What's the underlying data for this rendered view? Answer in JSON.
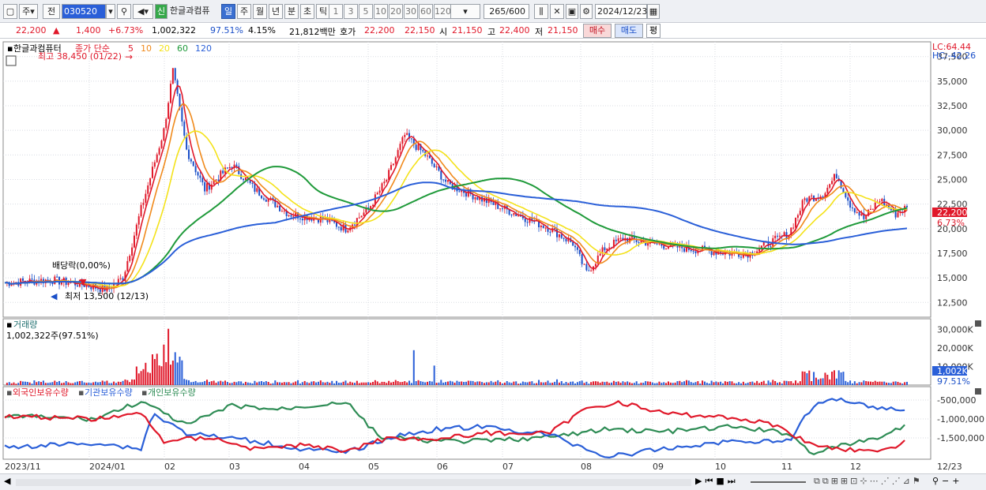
{
  "toolbar": {
    "period_main": "주",
    "prev": "전",
    "code": "030520",
    "new_badge": "신",
    "name": "한글과컴퓨",
    "periods": [
      "일",
      "주",
      "월",
      "년",
      "분",
      "초",
      "틱"
    ],
    "selected_period": "일",
    "intervals": [
      "1",
      "3",
      "5",
      "10",
      "20",
      "30",
      "60",
      "120"
    ],
    "count": "265",
    "total": "/600",
    "date": "2024/12/23"
  },
  "quote": {
    "price": "22,200",
    "change": "1,400",
    "rate": "+6.73%",
    "volume": "1,002,322",
    "vol_ratio": "97.51%",
    "turnover": "4.15%",
    "amount": "21,812백만",
    "ask_label": "호가",
    "ask1": "22,200",
    "ask2": "22,150",
    "open_label": "시",
    "open": "21,150",
    "high_label": "고",
    "high": "22,400",
    "low_label": "저",
    "low": "21,150",
    "buy": "매수",
    "sell": "매도",
    "eval": "평"
  },
  "price_panel": {
    "stock_name": "한글과컴퓨터",
    "legend_label": "종가 단순",
    "ma_periods": [
      "5",
      "10",
      "20",
      "60",
      "120"
    ],
    "ma_colors": [
      "#e0182a",
      "#f08a1c",
      "#f4e21a",
      "#1f9a3a",
      "#2a5fd8"
    ],
    "lc": "LC:64.44",
    "hc": "HC:-42.26",
    "high_note": "최고 38,450 (01/22)",
    "low_note": "최저 13,500 (12/13)",
    "dividend_note": "배당락(0,00%)",
    "price_tag": "22,200",
    "pct_tag": "6.73%"
  },
  "volume_panel": {
    "title": "거래량",
    "value": "1,002,322주(97.51%)",
    "y_ticks": [
      "30,000K",
      "20,000K",
      "10,000K"
    ],
    "tag": "1,002K",
    "tag2": "97.51%"
  },
  "holdings_panel": {
    "legend": [
      "외국인보유수량",
      "기관보유수량",
      "개인보유수량"
    ],
    "y_ticks": [
      "-500,000",
      "-1,000,000",
      "-1,500,000"
    ]
  },
  "x_axis": [
    "2023/11",
    "2024/01",
    "02",
    "03",
    "04",
    "05",
    "06",
    "07",
    "08",
    "09",
    "10",
    "11",
    "12",
    "12/23"
  ],
  "chart_data": {
    "type": "line",
    "title": "한글과컴퓨터",
    "y_ticks": [
      12500,
      15000,
      17500,
      20000,
      22500,
      25000,
      27500,
      30000,
      32500,
      35000,
      37500
    ],
    "ylim": [
      11000,
      39000
    ],
    "monthly_close": {
      "x": [
        "2023/11",
        "2023/12",
        "2024/01",
        "02",
        "03",
        "04",
        "05",
        "06",
        "07",
        "08",
        "09",
        "10",
        "11",
        "12"
      ],
      "values": [
        14800,
        14300,
        28000,
        26000,
        21500,
        20500,
        28500,
        24000,
        21500,
        17000,
        18500,
        17500,
        23500,
        22200
      ]
    },
    "last_close": 22200,
    "grid": true
  }
}
